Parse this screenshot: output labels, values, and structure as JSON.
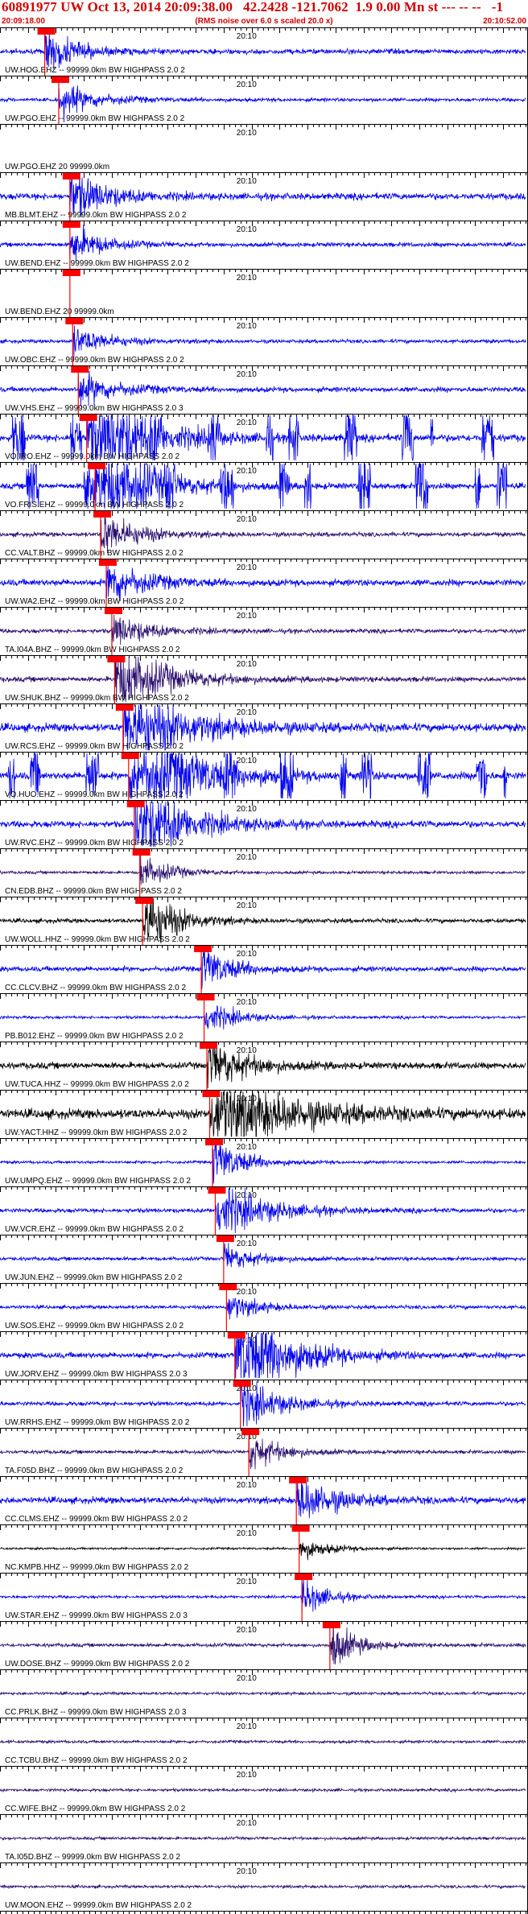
{
  "header": {
    "title": "60891977 UW Oct 13, 2014 20:09:38.00   42.2428 -121.7062  1.9 0.00 Mn st --- -- --   -1",
    "start_time": "20:09:18.00",
    "note": "(RMS noise over 6.0 s scaled 20.0 x)",
    "end_time": "20:10:52.00"
  },
  "chart_data": {
    "type": "line",
    "title": "60891977 UW Oct 13, 2014 20:09:38.00   42.2428 -121.7062  1.9 0.00 Mn st --- -- --   -1",
    "x_start": "20:09:18.00",
    "x_end": "20:10:52.00",
    "x_range_seconds": [
      0,
      94
    ],
    "minute_label": "20:10",
    "minute_mark_seconds": 42,
    "colors": {
      "blue": "#0000ee",
      "purple": "#2a0f6e",
      "black": "#000000",
      "pick": "#ff0000",
      "red_text": "#d00000"
    },
    "traces": [
      {
        "label": "UW.HOG.EHZ -- 99999.0km BW  HIGHPASS  2.0  2",
        "color": "blue",
        "pick_s": 8.0,
        "noise": 0.35,
        "event_amp": 0.8,
        "event_dur": 5
      },
      {
        "label": "UW.PGO.EHZ -- 99999.0km BW  HIGHPASS  2.0  2",
        "color": "blue",
        "pick_s": 10.5,
        "noise": 0.25,
        "event_amp": 0.6,
        "event_dur": 6
      },
      {
        "label": "UW.PGO.EHZ 20 99999.0km",
        "color": "blue",
        "pick_s": null,
        "noise": 0.0,
        "event_amp": 0.0,
        "event_dur": 0
      },
      {
        "label": "MB.BLMT.EHZ -- 99999.0km BW  HIGHPASS  2.0  2",
        "color": "blue",
        "pick_s": 12.5,
        "noise": 0.45,
        "event_amp": 0.9,
        "event_dur": 6
      },
      {
        "label": "UW.BEND.EHZ -- 99999.0km BW  HIGHPASS  2.0  2",
        "color": "blue",
        "pick_s": 12.5,
        "noise": 0.3,
        "event_amp": 0.7,
        "event_dur": 5
      },
      {
        "label": "UW.BEND.EHZ 20 99999.0km",
        "color": "blue",
        "pick_s": 12.5,
        "noise": 0.0,
        "event_amp": 0.0,
        "event_dur": 0
      },
      {
        "label": "UW.OBC.EHZ -- 99999.0km BW  HIGHPASS  2.0  2",
        "color": "blue",
        "pick_s": 13.0,
        "noise": 0.25,
        "event_amp": 0.5,
        "event_dur": 6
      },
      {
        "label": "UW.VHS.EHZ -- 99999.0km BW  HIGHPASS  2.0  3",
        "color": "blue",
        "pick_s": 14.0,
        "noise": 0.35,
        "event_amp": 0.6,
        "event_dur": 6
      },
      {
        "label": "VO.IRO.EHZ -- 99999.0km BW  HIGHPASS  2.0  2",
        "color": "blue",
        "pick_s": 15.5,
        "noise": 0.5,
        "event_amp": 2.4,
        "event_dur": 8,
        "bursty": true
      },
      {
        "label": "VO.FRIS.EHZ -- 99999.0km BW  HIGHPASS  2.0  2",
        "color": "blue",
        "pick_s": 17.0,
        "noise": 0.4,
        "event_amp": 2.0,
        "event_dur": 8,
        "bursty": true
      },
      {
        "label": "CC.VALT.BHZ -- 99999.0km BW  HIGHPASS  2.0  2",
        "color": "purple",
        "pick_s": 18.0,
        "noise": 0.3,
        "event_amp": 0.8,
        "event_dur": 6
      },
      {
        "label": "UW.WA2.EHZ -- 99999.0km BW  HIGHPASS  2.0  2",
        "color": "blue",
        "pick_s": 19.0,
        "noise": 0.45,
        "event_amp": 0.8,
        "event_dur": 6
      },
      {
        "label": "TA.I04A.BHZ -- 99999.0km BW  HIGHPASS  2.0  2",
        "color": "purple",
        "pick_s": 20.0,
        "noise": 0.3,
        "event_amp": 0.6,
        "event_dur": 6
      },
      {
        "label": "UW.SHUK.BHZ -- 99999.0km BW  HIGHPASS  2.0  2",
        "color": "purple",
        "pick_s": 20.5,
        "noise": 0.35,
        "event_amp": 1.3,
        "event_dur": 8
      },
      {
        "label": "UW.RCS.EHZ -- 99999.0km BW  HIGHPASS  2.0  2",
        "color": "blue",
        "pick_s": 22.0,
        "noise": 0.55,
        "event_amp": 1.5,
        "event_dur": 10
      },
      {
        "label": "VO.HUO.EHZ -- 99999.0km BW  HIGHPASS  2.0  2",
        "color": "blue",
        "pick_s": 23.0,
        "noise": 0.5,
        "event_amp": 2.2,
        "event_dur": 10,
        "bursty": true
      },
      {
        "label": "UW.RVC.EHZ -- 99999.0km BW  HIGHPASS  2.0  2",
        "color": "blue",
        "pick_s": 24.0,
        "noise": 0.45,
        "event_amp": 1.6,
        "event_dur": 8
      },
      {
        "label": "CN.EDB.BHZ -- 99999.0km BW  HIGHPASS  2.0  2",
        "color": "purple",
        "pick_s": 25.0,
        "noise": 0.2,
        "event_amp": 0.6,
        "event_dur": 5
      },
      {
        "label": "UW.WOLL.HHZ -- 99999.0km BW  HIGHPASS  2.0  2",
        "color": "black",
        "pick_s": 25.5,
        "noise": 0.3,
        "event_amp": 1.4,
        "event_dur": 5
      },
      {
        "label": "CC.CLCV.BHZ -- 99999.0km BW  HIGHPASS  2.0  2",
        "color": "blue",
        "pick_s": 36.0,
        "noise": 0.35,
        "event_amp": 0.8,
        "event_dur": 5
      },
      {
        "label": "PB.B012.EHZ -- 99999.0km BW  HIGHPASS  2.0  2",
        "color": "blue",
        "pick_s": 36.5,
        "noise": 0.2,
        "event_amp": 0.6,
        "event_dur": 5
      },
      {
        "label": "UW.TUCA.HHZ -- 99999.0km BW  HIGHPASS  2.0  2",
        "color": "black",
        "pick_s": 37.0,
        "noise": 0.45,
        "event_amp": 1.0,
        "event_dur": 6
      },
      {
        "label": "UW.YACT.HHZ -- 99999.0km BW  HIGHPASS  2.0  2",
        "color": "black",
        "pick_s": 37.5,
        "noise": 0.65,
        "event_amp": 1.6,
        "event_dur": 12
      },
      {
        "label": "UW.UMPQ.EHZ -- 99999.0km BW  HIGHPASS  2.0  2",
        "color": "blue",
        "pick_s": 38.0,
        "noise": 0.2,
        "event_amp": 0.9,
        "event_dur": 5
      },
      {
        "label": "UW.VCR.EHZ -- 99999.0km BW  HIGHPASS  2.0  2",
        "color": "blue",
        "pick_s": 38.5,
        "noise": 0.3,
        "event_amp": 1.0,
        "event_dur": 8
      },
      {
        "label": "UW.JUN.EHZ -- 99999.0km BW  HIGHPASS  2.0  2",
        "color": "blue",
        "pick_s": 40.0,
        "noise": 0.25,
        "event_amp": 0.5,
        "event_dur": 5
      },
      {
        "label": "UW.SOS.EHZ -- 99999.0km BW  HIGHPASS  2.0  2",
        "color": "blue",
        "pick_s": 40.5,
        "noise": 0.25,
        "event_amp": 0.5,
        "event_dur": 5
      },
      {
        "label": "UW.JORV.EHZ -- 99999.0km BW  HIGHPASS  2.0  3",
        "color": "blue",
        "pick_s": 42.0,
        "noise": 0.4,
        "event_amp": 2.2,
        "event_dur": 8
      },
      {
        "label": "UW.RRHS.EHZ -- 99999.0km BW  HIGHPASS  2.0  2",
        "color": "blue",
        "pick_s": 43.0,
        "noise": 0.3,
        "event_amp": 0.9,
        "event_dur": 6
      },
      {
        "label": "TA.F05D.BHZ -- 99999.0km BW  HIGHPASS  2.0  2",
        "color": "purple",
        "pick_s": 44.5,
        "noise": 0.25,
        "event_amp": 0.7,
        "event_dur": 5
      },
      {
        "label": "CC.CLMS.EHZ -- 99999.0km BW  HIGHPASS  2.0  2",
        "color": "blue",
        "pick_s": 53.0,
        "noise": 0.45,
        "event_amp": 0.9,
        "event_dur": 6
      },
      {
        "label": "NC.KMPB.HHZ -- 99999.0km BW  HIGHPASS  2.0  2",
        "color": "black",
        "pick_s": 53.5,
        "noise": 0.15,
        "event_amp": 0.4,
        "event_dur": 5
      },
      {
        "label": "UW.STAR.EHZ -- 99999.0km BW  HIGHPASS  2.0  3",
        "color": "blue",
        "pick_s": 54.0,
        "noise": 0.2,
        "event_amp": 0.7,
        "event_dur": 4
      },
      {
        "label": "UW.DOSE.BHZ -- 99999.0km BW  HIGHPASS  2.0  2",
        "color": "purple",
        "pick_s": 59.0,
        "noise": 0.25,
        "event_amp": 0.9,
        "event_dur": 4
      },
      {
        "label": "CC.PRLK.BHZ -- 99999.0km BW  HIGHPASS  2.0  3",
        "color": "purple",
        "pick_s": null,
        "noise": 0.2,
        "event_amp": 0.0,
        "event_dur": 0
      },
      {
        "label": "CC.TCBU.BHZ -- 99999.0km BW  HIGHPASS  2.0  2",
        "color": "purple",
        "pick_s": null,
        "noise": 0.2,
        "event_amp": 0.0,
        "event_dur": 0
      },
      {
        "label": "CC.WIFE.BHZ -- 99999.0km BW  HIGHPASS  2.0  2",
        "color": "purple",
        "pick_s": null,
        "noise": 0.2,
        "event_amp": 0.0,
        "event_dur": 0
      },
      {
        "label": "TA.I05D.BHZ -- 99999.0km BW  HIGHPASS  2.0  2",
        "color": "purple",
        "pick_s": null,
        "noise": 0.2,
        "event_amp": 0.0,
        "event_dur": 0
      },
      {
        "label": "UW.MOON.EHZ -- 99999.0km BW  HIGHPASS  2.0  2",
        "color": "purple",
        "pick_s": null,
        "noise": 0.2,
        "event_amp": 0.0,
        "event_dur": 0
      }
    ]
  }
}
